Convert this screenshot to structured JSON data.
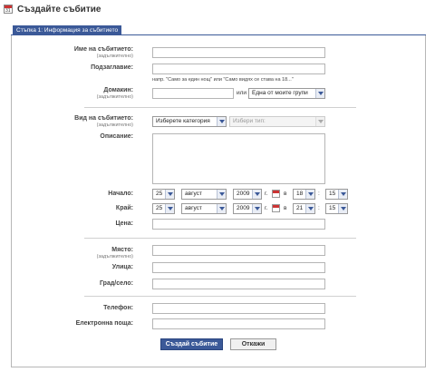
{
  "header": {
    "title": "Създайте събитие",
    "icon": "calendar-icon"
  },
  "tab": {
    "label": "Стъпка 1: Информация за събитието"
  },
  "form": {
    "required_note": "(задължително)",
    "event_name_label": "Име на събитието:",
    "tagline_label": "Подзаглавие:",
    "tagline_hint": "напр. \"Само за един нощ\" или \"Само видях се става на 18...\"",
    "host_label": "Домакин:",
    "host_or": "или",
    "host_group_select": "Една от моите групи",
    "type_label": "Вид на събитието:",
    "category_select": "Изберете категория",
    "subtype_select": "Избери тип:",
    "description_label": "Описание:",
    "start_label": "Начало:",
    "end_label": "Край:",
    "start": {
      "day": "25",
      "month": "август",
      "year": "2009",
      "year_suffix": "г.",
      "at": "в",
      "hour": "18",
      "colon": ":",
      "minute": "15"
    },
    "end": {
      "day": "25",
      "month": "август",
      "year": "2009",
      "year_suffix": "г.",
      "at": "в",
      "hour": "21",
      "colon": ":",
      "minute": "15"
    },
    "price_label": "Цена:",
    "place_label": "Място:",
    "street_label": "Улица:",
    "city_label": "Град/село:",
    "phone_label": "Телефон:",
    "email_label": "Електронна поща:"
  },
  "buttons": {
    "create": "Създай събитие",
    "cancel": "Откажи"
  },
  "colors": {
    "accent": "#3b5998",
    "border": "#b5b5b5"
  }
}
